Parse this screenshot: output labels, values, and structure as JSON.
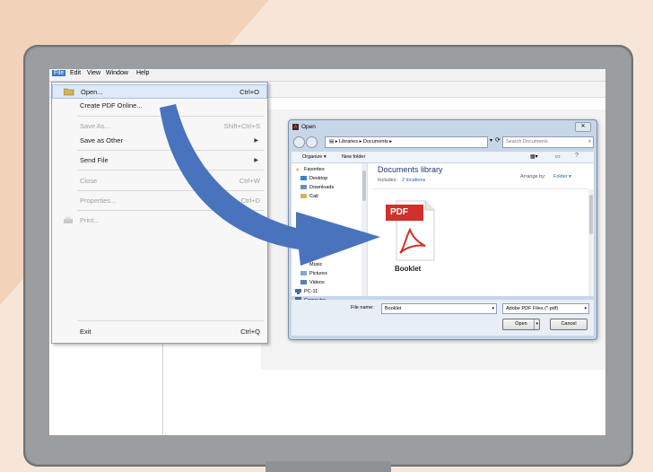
{
  "menubar": {
    "items": [
      "File",
      "Edit",
      "View",
      "Window",
      "Help"
    ]
  },
  "file_menu": {
    "items": [
      {
        "label": "Open...",
        "shortcut": "Ctrl+O"
      },
      {
        "label": "Create PDF Online...",
        "shortcut": ""
      },
      {
        "label": "Save As...",
        "shortcut": "Shift+Ctrl+S"
      },
      {
        "label": "Save as Other",
        "shortcut": ""
      },
      {
        "label": "Send File",
        "shortcut": ""
      },
      {
        "label": "Close",
        "shortcut": "Ctrl+W"
      },
      {
        "label": "Properties...",
        "shortcut": "Ctrl+D"
      },
      {
        "label": "Print...",
        "shortcut": ""
      },
      {
        "label": "Exit",
        "shortcut": "Ctrl+Q"
      }
    ]
  },
  "dialog": {
    "title": "Open",
    "close": "✕",
    "address": "▸ Libraries ▸ Documents ▸",
    "search_placeholder": "Search Documents",
    "organize": "Organize ▾",
    "new_folder": "New folder",
    "nav": [
      "Favorites",
      "Desktop",
      "Downloads",
      "Cait",
      "Doc...",
      "Music",
      "Pictures",
      "Videos",
      "PC-11",
      "Computer"
    ],
    "library_title": "Documents library",
    "includes_label": "Includes:",
    "includes_value": "2 locations",
    "arrange_label": "Arrange by:",
    "arrange_value": "Folder ▾",
    "file_icon_text": "PDF",
    "file_name": "Booklet",
    "filename_label": "File name:",
    "filename_value": "Booklet",
    "filetype": "Adobe PDF Files (*.pdf)",
    "open_button": "Open",
    "cancel_button": "Cancel"
  },
  "colors": {
    "arrow": "#4a73bd",
    "pdf_red": "#d2302a",
    "menu_highlight": "#dde9f7"
  }
}
